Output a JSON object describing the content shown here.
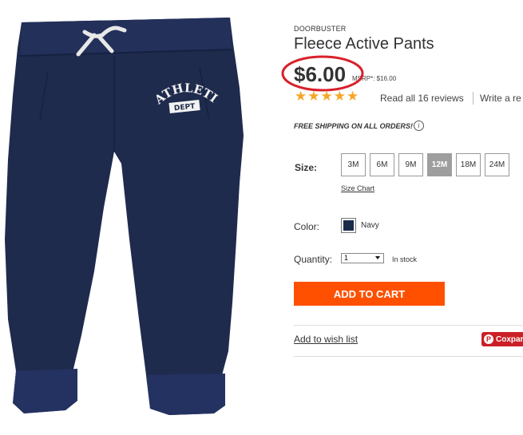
{
  "product": {
    "eyebrow": "DOORBUSTER",
    "title": "Fleece Active Pants",
    "price": "$6.00",
    "msrp": "MSRP*: $16.00",
    "rating_stars": 5,
    "reviews_link": "Read all 16 reviews",
    "write_review": "Write a re",
    "shipping": "FREE SHIPPING ON ALL ORDERS!",
    "image_text": {
      "line1": "ATHLETIC",
      "line2": "DEPT"
    }
  },
  "size": {
    "label": "Size:",
    "options": [
      "3M",
      "6M",
      "9M",
      "12M",
      "18M",
      "24M"
    ],
    "selected": "12M",
    "chart_link": "Size Chart"
  },
  "color": {
    "label": "Color:",
    "name": "Navy",
    "swatch": "#1c2b4a"
  },
  "quantity": {
    "label": "Quantity:",
    "value": "1",
    "stock": "In stock"
  },
  "actions": {
    "add_to_cart": "ADD TO CART",
    "wishlist": "Add to wish list",
    "pin": "Coxpar"
  },
  "colors": {
    "accent": "#ff5000",
    "star": "#f5a623",
    "highlight_circle": "#d9202a",
    "pinterest": "#cb2027"
  }
}
